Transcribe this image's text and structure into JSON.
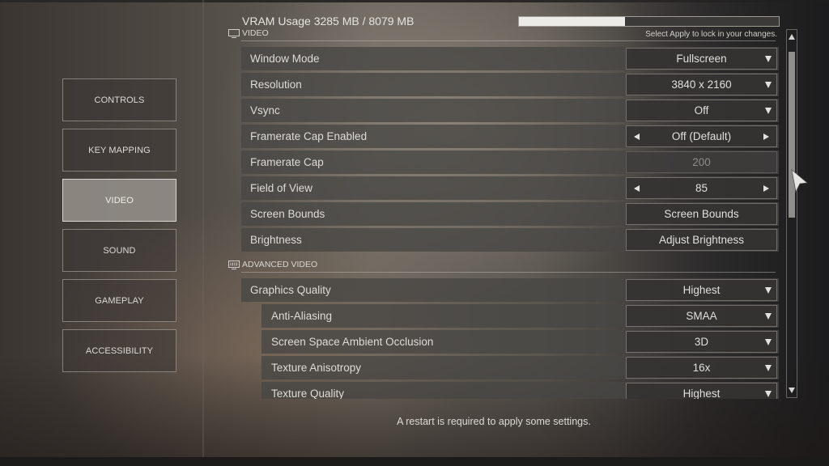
{
  "nav": {
    "items": [
      {
        "label": "CONTROLS",
        "active": false
      },
      {
        "label": "KEY MAPPING",
        "active": false
      },
      {
        "label": "VIDEO",
        "active": true
      },
      {
        "label": "SOUND",
        "active": false
      },
      {
        "label": "GAMEPLAY",
        "active": false
      },
      {
        "label": "ACCESSIBILITY",
        "active": false
      }
    ]
  },
  "header": {
    "vram_label": "VRAM Usage 3285 MB / 8079 MB",
    "vram_used_mb": 3285,
    "vram_total_mb": 8079,
    "apply_hint": "Select Apply to lock in your changes."
  },
  "sections": {
    "video": {
      "title": "VIDEO",
      "icon": "monitor-icon"
    },
    "advanced_video": {
      "title": "ADVANCED VIDEO",
      "icon": "advanced-monitor-icon"
    }
  },
  "video_settings": [
    {
      "label": "Window Mode",
      "value": "Fullscreen",
      "control": "dropdown"
    },
    {
      "label": "Resolution",
      "value": "3840 x 2160",
      "control": "dropdown"
    },
    {
      "label": "Vsync",
      "value": "Off",
      "control": "dropdown"
    },
    {
      "label": "Framerate Cap Enabled",
      "value": "Off (Default)",
      "control": "stepper"
    },
    {
      "label": "Framerate Cap",
      "value": "200",
      "control": "disabled"
    },
    {
      "label": "Field of View",
      "value": "85",
      "control": "stepper"
    },
    {
      "label": "Screen Bounds",
      "value": "Screen Bounds",
      "control": "button"
    },
    {
      "label": "Brightness",
      "value": "Adjust Brightness",
      "control": "button"
    }
  ],
  "advanced_settings": [
    {
      "label": "Graphics Quality",
      "value": "Highest",
      "control": "dropdown",
      "indent": false
    },
    {
      "label": "Anti-Aliasing",
      "value": "SMAA",
      "control": "dropdown",
      "indent": true
    },
    {
      "label": "Screen Space Ambient Occlusion",
      "value": "3D",
      "control": "dropdown",
      "indent": true
    },
    {
      "label": "Texture Anisotropy",
      "value": "16x",
      "control": "dropdown",
      "indent": true
    },
    {
      "label": "Texture Quality",
      "value": "Highest",
      "control": "dropdown",
      "indent": true
    }
  ],
  "scrollbar": {
    "position_fraction": 0.0,
    "visible_fraction": 0.45
  },
  "footer": {
    "message": "A restart is required to apply some settings."
  }
}
